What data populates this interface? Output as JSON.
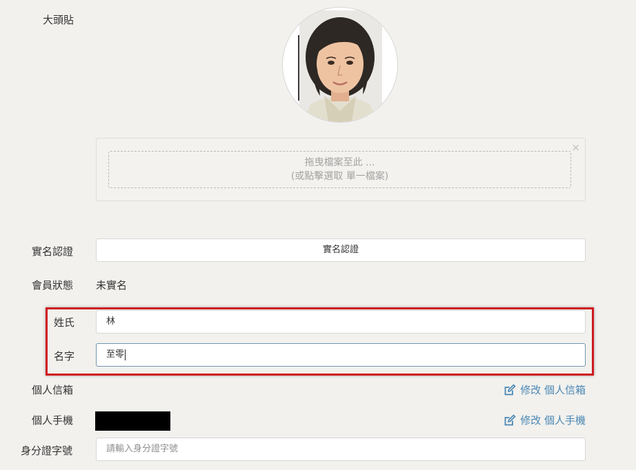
{
  "colors": {
    "page_bg": "#f2f1ee",
    "link": "#4a87b4",
    "highlight": "#d0191f"
  },
  "avatar": {
    "label": "大頭貼",
    "photo_icon": "person-photo"
  },
  "dropzone": {
    "line1": "拖曳檔案至此 ...",
    "line2": "(或點擊選取 單一檔案)",
    "close_symbol": "×"
  },
  "verification": {
    "label": "實名認證",
    "button_label": "實名認證"
  },
  "member_status": {
    "label": "會員狀態",
    "value": "未實名"
  },
  "surname": {
    "label": "姓氏",
    "value": "林"
  },
  "given_name": {
    "label": "名字",
    "value": "至零"
  },
  "email": {
    "label": "個人信箱",
    "edit_label": "修改 個人信箱",
    "edit_icon": "edit-icon"
  },
  "phone": {
    "label": "個人手機",
    "edit_label": "修改 個人手機",
    "edit_icon": "edit-icon"
  },
  "id_number": {
    "label": "身分證字號",
    "placeholder": "請輸入身分證字號"
  }
}
